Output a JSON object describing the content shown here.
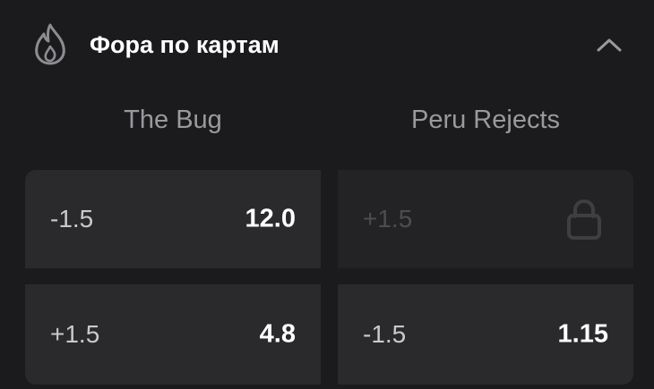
{
  "header": {
    "title": "Фора по картам",
    "icon": "fire-icon",
    "collapse_icon": "chevron-up-icon"
  },
  "teams": [
    {
      "name": "The Bug"
    },
    {
      "name": "Peru Rejects"
    }
  ],
  "odds": [
    {
      "team": "The Bug",
      "handicap": "-1.5",
      "coef": "12.0",
      "locked": false
    },
    {
      "team": "Peru Rejects",
      "handicap": "+1.5",
      "coef": "",
      "locked": true,
      "icon": "lock-icon"
    },
    {
      "team": "The Bug",
      "handicap": "+1.5",
      "coef": "4.8",
      "locked": false
    },
    {
      "team": "Peru Rejects",
      "handicap": "-1.5",
      "coef": "1.15",
      "locked": false
    }
  ],
  "colors": {
    "background": "#1b1b1d",
    "cell": "#2a2a2d",
    "cell_locked": "#232325",
    "muted_text": "#9a9a9e",
    "icon": "#8d8d91"
  }
}
